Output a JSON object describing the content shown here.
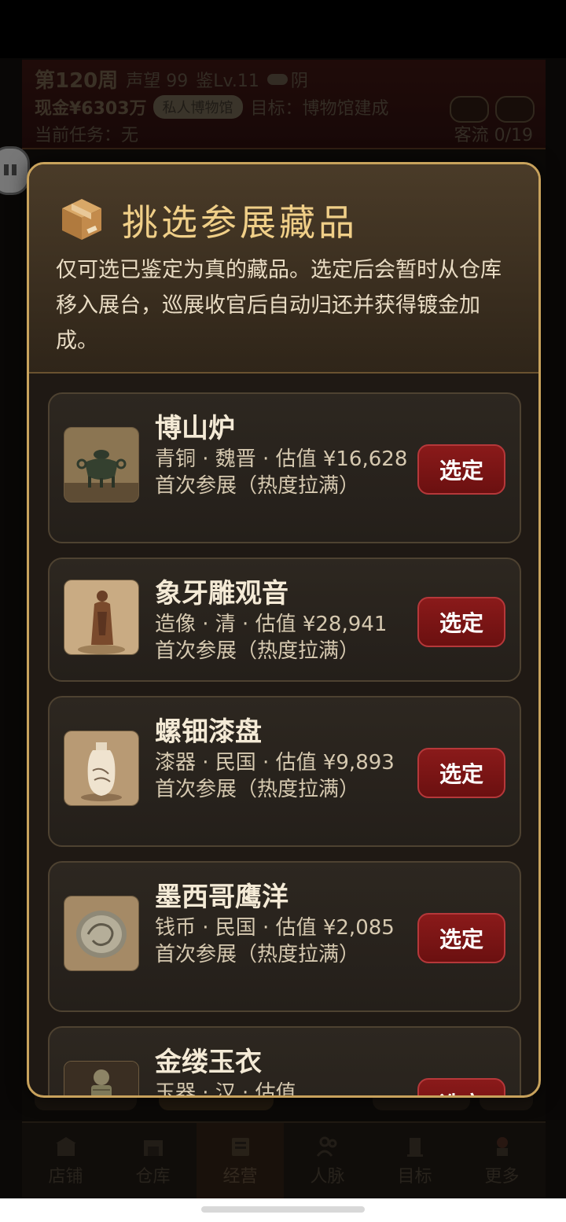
{
  "header": {
    "week": "第120周",
    "reputation": "声望 99",
    "appraise_level": "鉴Lv.11",
    "weather": "阴",
    "cash": "现金¥6303万",
    "museum_badge": "私人博物馆",
    "goal": "目标：博物馆建成",
    "task": "当前任务：无",
    "visitors": "客流 0/19"
  },
  "modal": {
    "icon": "package-box-icon",
    "title": "挑选参展藏品",
    "description": "仅可选已鉴定为真的藏品。选定后会暂时从仓库移入展台，巡展收官后自动归还并获得镀金加成。",
    "items": [
      {
        "name": "博山炉",
        "meta": "青铜 · 魏晋 · 估值 ¥16,628",
        "status": "首次参展（热度拉满）",
        "button": "选定",
        "thumb": "bronze-censer-image"
      },
      {
        "name": "象牙雕观音",
        "meta": "造像 · 清 · 估值 ¥28,941",
        "status": "首次参展（热度拉满）",
        "button": "选定",
        "thumb": "ivory-statue-image"
      },
      {
        "name": "螺钿漆盘",
        "meta": "漆器 · 民国 · 估值 ¥9,893",
        "status": "首次参展（热度拉满）",
        "button": "选定",
        "thumb": "porcelain-vase-image"
      },
      {
        "name": "墨西哥鹰洋",
        "meta": "钱币 · 民国 · 估值 ¥2,085",
        "status": "首次参展（热度拉满）",
        "button": "选定",
        "thumb": "silver-coin-image"
      },
      {
        "name": "金缕玉衣",
        "meta": "玉器 · 汉 · 估值",
        "status": "",
        "button": "选定",
        "thumb": "jade-suit-image"
      }
    ]
  },
  "nav": [
    {
      "label": "店铺",
      "icon": "shop-icon"
    },
    {
      "label": "仓库",
      "icon": "warehouse-icon"
    },
    {
      "label": "经营",
      "icon": "business-icon"
    },
    {
      "label": "人脉",
      "icon": "people-icon"
    },
    {
      "label": "目标",
      "icon": "target-icon"
    },
    {
      "label": "更多",
      "icon": "more-icon"
    }
  ],
  "colors": {
    "accent_gold": "#c8a25c",
    "title_gold": "#f0cf88",
    "button_red": "#7a1414"
  }
}
